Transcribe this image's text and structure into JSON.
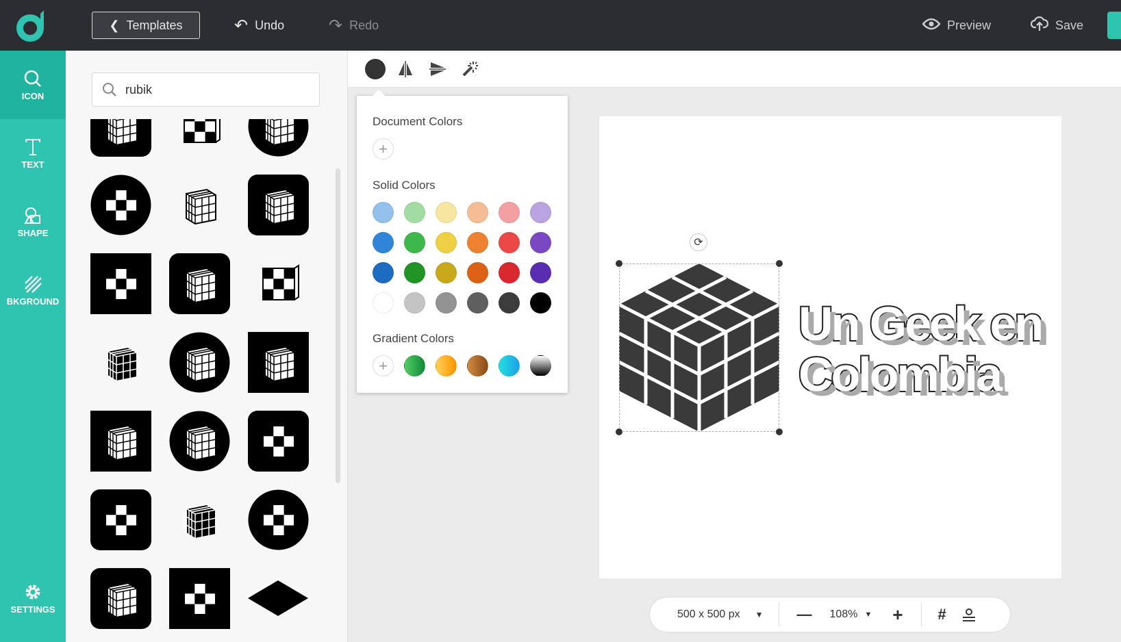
{
  "topbar": {
    "templates_label": "Templates",
    "undo_label": "Undo",
    "redo_label": "Redo",
    "preview_label": "Preview",
    "save_label": "Save"
  },
  "sidebar": {
    "items": [
      {
        "label": "ICON",
        "icon": "search-icon",
        "active": true
      },
      {
        "label": "TEXT",
        "icon": "text-icon"
      },
      {
        "label": "SHAPE",
        "icon": "shape-icon"
      },
      {
        "label": "BKGROUND",
        "icon": "background-icon"
      },
      {
        "label": "SETTINGS",
        "icon": "gear-icon"
      }
    ]
  },
  "search": {
    "value": "rubik"
  },
  "icon_results": [
    "cube-rounded",
    "checker-cube",
    "cube-circle",
    "checker-circle",
    "cube-outline",
    "cube-rounded",
    "checker-square",
    "cube-rounded",
    "checker-cube",
    "cube-dark",
    "cube-circle",
    "cube-square",
    "cube-square",
    "cube-circle-dark",
    "checker-rounded",
    "checker-rounded",
    "cube-dark",
    "checker-circle",
    "cube-rounded",
    "checker-square",
    "diamond"
  ],
  "color_popover": {
    "document_title": "Document Colors",
    "solid_title": "Solid Colors",
    "gradient_title": "Gradient Colors",
    "solid_colors": [
      [
        "#94c0ec",
        "#a3dca3",
        "#f7e6a0",
        "#f5bd95",
        "#f3a0a3",
        "#b9a3e0"
      ],
      [
        "#2f86d9",
        "#3cb94a",
        "#efd040",
        "#ee8230",
        "#ec4848",
        "#7b48c4"
      ],
      [
        "#1e6cc1",
        "#1f9526",
        "#c9a81a",
        "#dd6215",
        "#d9282e",
        "#5b2db2"
      ],
      [
        "#ffffff",
        "#c4c4c4",
        "#939393",
        "#5f5f5f",
        "#3c3c3c",
        "#000000"
      ]
    ],
    "gradient_colors": [
      [
        "#55cc66",
        "#0f8a3a"
      ],
      [
        "#ffd055",
        "#ff9500"
      ],
      [
        "#d08a45",
        "#8a4a15"
      ],
      [
        "#20e0e0",
        "#20a0e8"
      ],
      [
        "#ffffff",
        "#000000"
      ]
    ]
  },
  "selected_color": "#333333",
  "canvas": {
    "brand_line1": "Un Geek en",
    "brand_line2": "Colombia"
  },
  "bottombar": {
    "size_label": "500 x 500 px",
    "zoom_label": "108%"
  },
  "accent": "#2ec4b0"
}
